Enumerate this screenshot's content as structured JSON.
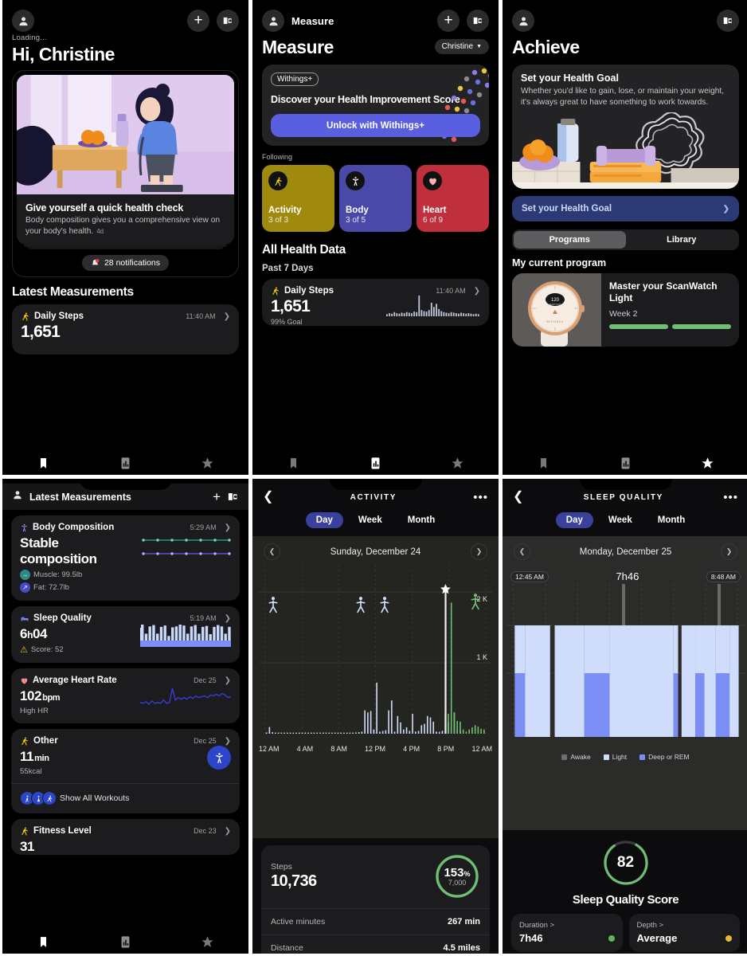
{
  "panels": {
    "home": {
      "topbar": {
        "plus_label": "+",
        "device_label": "device-sync"
      },
      "loading": "Loading...",
      "greeting": "Hi, Christine",
      "hero": {
        "heading": "Give yourself a quick health check",
        "body": "Body composition gives you a comprehensive view on your body's health.",
        "ago": "4d"
      },
      "notifications": "28 notifications",
      "section_title": "Latest Measurements",
      "measurement": {
        "title": "Daily Steps",
        "time": "11:40 AM",
        "value": "1,651"
      },
      "tabs": [
        "bookmark-icon",
        "chart-icon",
        "star-icon"
      ],
      "active_tab": 0
    },
    "measure": {
      "topbar_title": "Measure",
      "page_title": "Measure",
      "user_chip": "Christine",
      "promo": {
        "badge": "Withings+",
        "heading": "Discover your Health Improvement Score",
        "cta": "Unlock with Withings+"
      },
      "following_label": "Following",
      "tiles": [
        {
          "label": "Activity",
          "count": "3 of 3",
          "color": "#a08a0e",
          "icon": "runner-icon",
          "icon_color": "#f2c800"
        },
        {
          "label": "Body",
          "count": "3 of 5",
          "color": "#4a48a8",
          "icon": "body-icon",
          "icon_color": "#ffffff"
        },
        {
          "label": "Heart",
          "count": "6 of 9",
          "color": "#c0303c",
          "icon": "heart-icon",
          "icon_color": "#f7b3b3"
        }
      ],
      "all_health_data": "All Health Data",
      "past_7_days": "Past 7 Days",
      "measurement": {
        "title": "Daily Steps",
        "time": "11:40 AM",
        "value": "1,651",
        "goal": "99% Goal"
      },
      "active_tab": 1
    },
    "achieve": {
      "page_title": "Achieve",
      "goal_card": {
        "heading": "Set your Health Goal",
        "body": "Whether you'd like to gain, lose, or maintain your weight, it's always great to have something to work towards."
      },
      "goal_button": "Set your Health Goal",
      "segments": [
        "Programs",
        "Library"
      ],
      "active_segment": 0,
      "my_current_program": "My current program",
      "program": {
        "title": "Master your ScanWatch Light",
        "week": "Week 2",
        "watch_value": "120",
        "brand": "WITHINGS",
        "progress_segments": 2
      },
      "active_tab": 2
    },
    "latest_measurements": {
      "topbar_title": "Latest Measurements",
      "cards": [
        {
          "title": "Body Composition",
          "icon": "body-icon",
          "icon_color": "#b48ef0",
          "date": "5:29 AM",
          "value": "Stable composition",
          "sub": [
            {
              "label": "Muscle: 99.5lb",
              "color": "#2e8b84",
              "arrow": "→"
            },
            {
              "label": "Fat: 72.7lb",
              "color": "#4a48c8",
              "arrow": "↗"
            }
          ],
          "graph": "dual-line-flat"
        },
        {
          "title": "Sleep Quality",
          "icon": "bed-icon",
          "icon_color": "#7a86e8",
          "date": "5:19 AM",
          "value": "6",
          "value_unit": "h",
          "value_tail": "04",
          "sub": [
            {
              "label": "Score: 52",
              "color": "#e8b931",
              "arrow": "!"
            }
          ],
          "graph": "sleep-bars"
        },
        {
          "title": "Average Heart Rate",
          "icon": "heart-icon",
          "icon_color": "#f08b8b",
          "date": "Dec 25",
          "value": "102",
          "value_unit": "bpm",
          "sub": [
            {
              "label": "High HR",
              "color": "",
              "arrow": ""
            }
          ],
          "graph": "hr-line"
        },
        {
          "title": "Other",
          "icon": "runner-icon",
          "icon_color": "#f2c800",
          "date": "Dec 25",
          "value": "11",
          "value_unit": "min",
          "sub": [
            {
              "label": "55kcal",
              "color": "",
              "arrow": ""
            }
          ],
          "workouts_label": "Show All Workouts",
          "graph": "badge"
        },
        {
          "title": "Fitness Level",
          "icon": "runner-icon",
          "icon_color": "#f2c800",
          "date": "Dec 23",
          "value": "31",
          "graph": "none"
        }
      ],
      "active_tab": 0
    },
    "activity": {
      "header_title": "ACTIVITY",
      "segments": [
        "Day",
        "Week",
        "Month"
      ],
      "active_segment": 0,
      "date": "Sunday, December 24",
      "stats": {
        "steps_label": "Steps",
        "steps_value": "10,736",
        "percent": "153",
        "percent_symbol": "%",
        "goal": "7,000",
        "rows": [
          {
            "label": "Active minutes",
            "value": "267 min"
          },
          {
            "label": "Distance",
            "value": "4.5 miles"
          }
        ]
      },
      "active_tab": 1
    },
    "sleep": {
      "header_title": "SLEEP QUALITY",
      "segments": [
        "Day",
        "Week",
        "Month"
      ],
      "active_segment": 0,
      "date": "Monday, December 25",
      "start_time": "12:45 AM",
      "duration": "7h46",
      "end_time": "8:48 AM",
      "legend": [
        {
          "label": "Awake",
          "color": "#6e6e70"
        },
        {
          "label": "Light",
          "color": "#cfdcfb"
        },
        {
          "label": "Deep or REM",
          "color": "#7b8ef5"
        }
      ],
      "score": "82",
      "score_label": "Sleep Quality Score",
      "cards": [
        {
          "key": "Duration >",
          "value": "7h46",
          "dot": "#57b85e"
        },
        {
          "key": "Depth >",
          "value": "Average",
          "dot": "#e8b931"
        }
      ],
      "active_tab": 2
    }
  },
  "chart_data": [
    {
      "type": "bar",
      "title": "Activity — Sunday, December 24",
      "xlabel": "",
      "ylabel": "Steps",
      "ylim": [
        0,
        2000
      ],
      "ytick_labels": [
        "1 K",
        "2 K"
      ],
      "xtick_labels": [
        "12 AM",
        "4 AM",
        "8 AM",
        "12 PM",
        "4 PM",
        "8 PM",
        "12 AM"
      ],
      "peak_marker": {
        "label": "star",
        "value": 2000,
        "x": "6 PM"
      },
      "series": [
        {
          "name": "Steps (walking)",
          "color": "#cfdcfb",
          "values": [
            18,
            95,
            22,
            14,
            12,
            16,
            12,
            10,
            14,
            10,
            12,
            10,
            14,
            12,
            10,
            12,
            14,
            10,
            12,
            10,
            14,
            12,
            10,
            12,
            14,
            12,
            10,
            14,
            12,
            16,
            18,
            22,
            30,
            330,
            300,
            320,
            60,
            720,
            30,
            40,
            50,
            330,
            470,
            30,
            250,
            160,
            60,
            90,
            40,
            280,
            30,
            40,
            120,
            140,
            250,
            230,
            170,
            30,
            26,
            40,
            300,
            160,
            90,
            300,
            60,
            40
          ]
        },
        {
          "name": "Steps (active)",
          "color": "#6fbf73",
          "values": [
            0,
            0,
            0,
            0,
            0,
            0,
            0,
            0,
            0,
            0,
            0,
            0,
            0,
            0,
            0,
            0,
            0,
            0,
            0,
            0,
            0,
            0,
            0,
            0,
            0,
            0,
            0,
            0,
            0,
            0,
            0,
            0,
            0,
            0,
            0,
            0,
            0,
            0,
            0,
            0,
            0,
            0,
            0,
            0,
            0,
            0,
            0,
            0,
            0,
            0,
            0,
            0,
            0,
            0,
            0,
            0,
            0,
            0,
            0,
            0,
            990,
            280,
            1850,
            300,
            180,
            170,
            60,
            30,
            60,
            90,
            120,
            100,
            70,
            60
          ]
        }
      ],
      "annotations": {
        "peak_total": 2000
      }
    },
    {
      "type": "area",
      "title": "Sleep hypnogram — Monday, December 25",
      "xlim_labels": [
        "12:45 AM",
        "8:48 AM"
      ],
      "duration": "7h46",
      "legend_position": "bottom",
      "categories": [
        "Awake",
        "Light",
        "Deep or REM"
      ],
      "colors": [
        "#3a3a3c",
        "#cfdcfb",
        "#7b8ef5"
      ],
      "segments": [
        {
          "stage": "Deep or REM",
          "start_pct": 1.5,
          "width_pct": 4.5
        },
        {
          "stage": "Light",
          "start_pct": 6,
          "width_pct": 11
        },
        {
          "stage": "Awake",
          "start_pct": 17,
          "width_pct": 2
        },
        {
          "stage": "Light",
          "start_pct": 19,
          "width_pct": 13
        },
        {
          "stage": "Deep or REM",
          "start_pct": 32,
          "width_pct": 11
        },
        {
          "stage": "Light",
          "start_pct": 43,
          "width_pct": 28
        },
        {
          "stage": "Deep or REM",
          "start_pct": 71,
          "width_pct": 2
        },
        {
          "stage": "Awake",
          "start_pct": 73,
          "width_pct": 1.5
        },
        {
          "stage": "Light",
          "start_pct": 74.5,
          "width_pct": 6
        },
        {
          "stage": "Deep or REM",
          "start_pct": 80.5,
          "width_pct": 4
        },
        {
          "stage": "Light",
          "start_pct": 84.5,
          "width_pct": 5
        },
        {
          "stage": "Deep or REM",
          "start_pct": 89.5,
          "width_pct": 6
        },
        {
          "stage": "Light",
          "start_pct": 95.5,
          "width_pct": 4
        }
      ]
    },
    {
      "type": "line",
      "title": "Average Heart Rate trend",
      "color": "#3a3ad8",
      "values": [
        46,
        44,
        48,
        42,
        50,
        44,
        46,
        44,
        52,
        44,
        46,
        80,
        52,
        58,
        54,
        58,
        54,
        60,
        56,
        62,
        58,
        60,
        62,
        58,
        64,
        62,
        66,
        62,
        68,
        64,
        58,
        60
      ]
    },
    {
      "type": "bar",
      "title": "Sleep Quality mini bars",
      "color": "#cfdcfb",
      "values": [
        70,
        30,
        62,
        68,
        30,
        60,
        66,
        20,
        58,
        62,
        70,
        66,
        30,
        62,
        68,
        30,
        60,
        64,
        28,
        60,
        68,
        62,
        30,
        60
      ]
    },
    {
      "type": "line",
      "title": "Body Composition trend (Muscle / Fat)",
      "series": [
        {
          "name": "Muscle",
          "color": "#2fa79c",
          "values": [
            50,
            50,
            50,
            50,
            50,
            50,
            50
          ]
        },
        {
          "name": "Fat",
          "color": "#6a5ce8",
          "values": [
            50,
            50,
            50,
            50,
            50,
            50,
            50
          ]
        }
      ]
    },
    {
      "type": "bar",
      "title": "Daily Steps sparkline",
      "color": "#bfc8d8",
      "values": [
        4,
        6,
        5,
        8,
        6,
        5,
        7,
        6,
        8,
        7,
        6,
        9,
        8,
        40,
        12,
        10,
        9,
        12,
        26,
        18,
        24,
        14,
        10,
        8,
        7,
        6,
        8,
        7,
        6,
        5,
        7,
        6,
        5,
        6,
        5,
        4,
        5,
        4
      ]
    }
  ]
}
